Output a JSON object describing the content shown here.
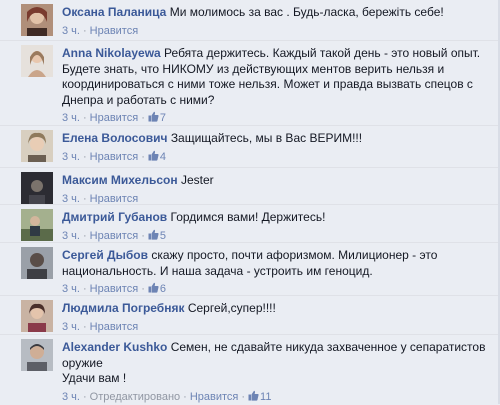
{
  "comments": [
    {
      "author": "Оксана Паланица",
      "text": "Ми молимось за вас . Будь-ласка, бережіть себе!",
      "time": "3 ч.",
      "like_label": "Нравится",
      "likes": "",
      "edited": "",
      "avatar_color": "#7a3b2e"
    },
    {
      "author": "Anna Nikolayewa",
      "text": "Ребята держитесь. Каждый такой день - это новый опыт. Будете знать, что НИКОМУ из действующих ментов верить нельзя и координироваться с ними тоже нельзя. Может и правда вызвать спецов с Днепра и работать с ними?",
      "time": "3 ч.",
      "like_label": "Нравится",
      "likes": "7",
      "edited": "",
      "avatar_color": "#c9a28a"
    },
    {
      "author": "Елена Волосович",
      "text": "Защищайтесь, мы в Вас ВЕРИМ!!!",
      "time": "3 ч.",
      "like_label": "Нравится",
      "likes": "4",
      "edited": "",
      "avatar_color": "#8f7a5c"
    },
    {
      "author": "Максим Михельсон",
      "text": "Jester",
      "time": "3 ч.",
      "like_label": "Нравится",
      "likes": "",
      "edited": "",
      "avatar_color": "#4a4a52"
    },
    {
      "author": "Дмитрий Губанов",
      "text": "Гордимся вами! Держитесь!",
      "time": "3 ч.",
      "like_label": "Нравится",
      "likes": "5",
      "edited": "",
      "avatar_color": "#5b6b4a"
    },
    {
      "author": "Сергей Дыбов",
      "text": "скажу просто, почти афоризмом. Милиционер - это национальность. И наша задача - устроить им геноцид.",
      "time": "3 ч.",
      "like_label": "Нравится",
      "likes": "6",
      "edited": "",
      "avatar_color": "#3e3f44"
    },
    {
      "author": "Людмила Погребняк",
      "text": "Сергей,супер!!!!",
      "time": "3 ч.",
      "like_label": "Нравится",
      "likes": "",
      "edited": "",
      "avatar_color": "#8a3a4a"
    },
    {
      "author": "Alexander Kushko",
      "text": "Семен, не сдавайте никуда захваченное у сепаратистов оружие\nУдачи вам !",
      "time": "3 ч.",
      "like_label": "Нравится",
      "likes": "11",
      "edited": "Отредактировано",
      "avatar_color": "#5d5f66"
    }
  ],
  "colors": {
    "background": "#eaedf3",
    "author_link": "#3b5998",
    "meta_link": "#6d84b4",
    "meta_text": "#9197a3"
  },
  "icons": {
    "like": "thumbs-up-icon"
  }
}
